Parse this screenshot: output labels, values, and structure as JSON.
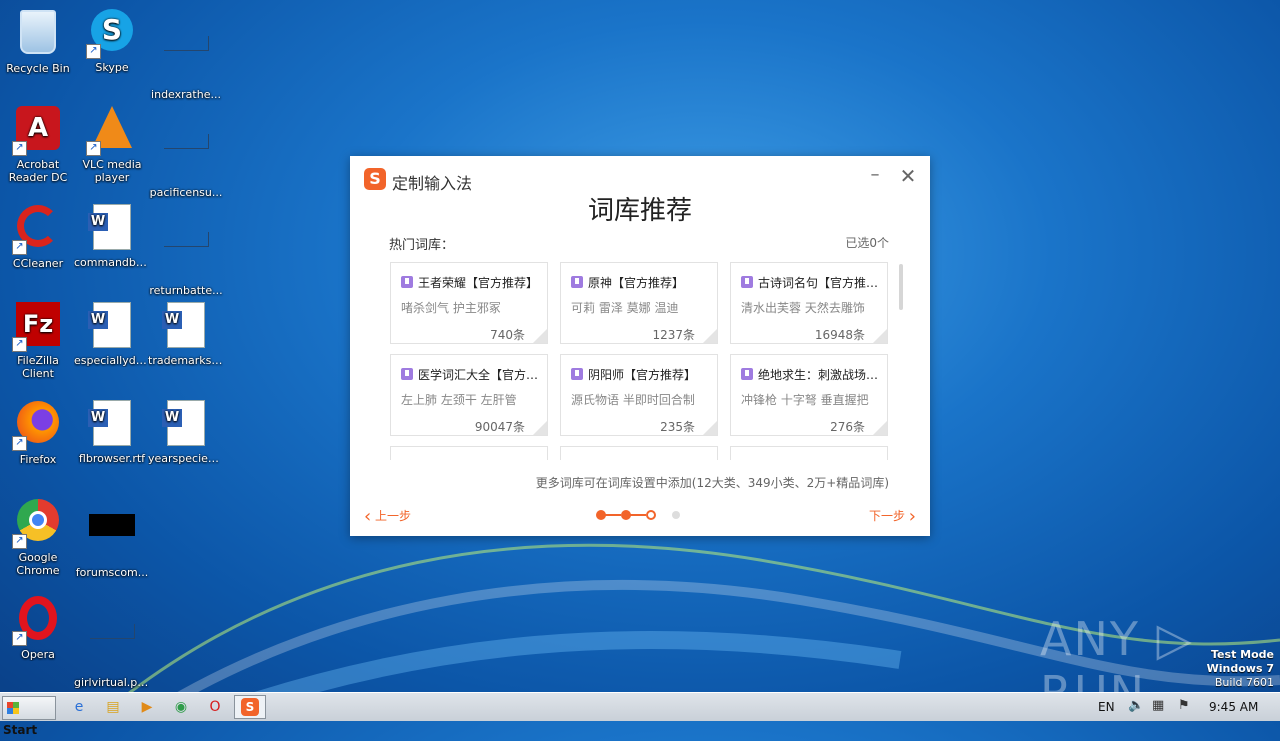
{
  "desktop_icons": [
    {
      "label": "Recycle Bin",
      "icon": "recycle-bin-icon"
    },
    {
      "label": "Skype",
      "icon": "skype-icon"
    },
    {
      "label": "indexrathe...",
      "icon": "blank-file-icon"
    },
    {
      "label": "Acrobat Reader DC",
      "icon": "acrobat-icon"
    },
    {
      "label": "VLC media player",
      "icon": "vlc-icon"
    },
    {
      "label": "pacificensu...",
      "icon": "blank-file-icon"
    },
    {
      "label": "CCleaner",
      "icon": "ccleaner-icon"
    },
    {
      "label": "commandbo...",
      "icon": "word-doc-icon"
    },
    {
      "label": "returnbatte...",
      "icon": "blank-file-icon"
    },
    {
      "label": "FileZilla Client",
      "icon": "filezilla-icon"
    },
    {
      "label": "especiallyde...",
      "icon": "word-doc-icon"
    },
    {
      "label": "trademarksc...",
      "icon": "word-doc-icon"
    },
    {
      "label": "Firefox",
      "icon": "firefox-icon"
    },
    {
      "label": "flbrowser.rtf",
      "icon": "word-doc-icon"
    },
    {
      "label": "yearspecies...",
      "icon": "word-doc-icon"
    },
    {
      "label": "Google Chrome",
      "icon": "chrome-icon"
    },
    {
      "label": "forumscom...",
      "icon": "black-image-icon"
    },
    {
      "label": "Opera",
      "icon": "opera-icon"
    },
    {
      "label": "girlvirtual.png",
      "icon": "blank-file-icon"
    }
  ],
  "dialog": {
    "app_title": "定制输入法",
    "logo_glyph": "S",
    "heading": "词库推荐",
    "section_label": "热门词库：",
    "selected_count": "已选0个",
    "cards": [
      {
        "title": "王者荣耀【官方推荐】",
        "desc": "啫杀剑气 护主邪冢",
        "count": "740条"
      },
      {
        "title": "原神【官方推荐】",
        "desc": "可莉 雷泽 莫娜 温迪",
        "count": "1237条"
      },
      {
        "title": "古诗词名句【官方推荐】",
        "desc": "清水出芙蓉 天然去雕饰",
        "count": "16948条"
      },
      {
        "title": "医学词汇大全【官方推荐】",
        "desc": "左上肺 左颈干 左肝管",
        "count": "90047条"
      },
      {
        "title": "阴阳师【官方推荐】",
        "desc": "源氏物语 半即时回合制",
        "count": "235条"
      },
      {
        "title": "绝地求生：刺激战场【官方推荐】",
        "desc": "冲锋枪 十字弩 垂直握把",
        "count": "276条"
      },
      {
        "title": "",
        "desc": "",
        "count": ""
      },
      {
        "title": "",
        "desc": "",
        "count": ""
      },
      {
        "title": "",
        "desc": "",
        "count": ""
      }
    ],
    "more_note": "更多词库可在词库设置中添加(12大类、349小类、2万+精品词库)",
    "prev_label": "上一步",
    "next_label": "下一步",
    "steps_total": 4,
    "current_step": 3
  },
  "watermark": "ANY ▷ RUN",
  "test_mode": {
    "line1": "Test Mode",
    "line2": "Windows 7",
    "line3": "Build 7601"
  },
  "taskbar": {
    "start_label": "Start",
    "pinned": [
      "ie-icon",
      "explorer-icon",
      "media-player-icon",
      "chrome-icon",
      "opera-icon",
      "sogou-icon"
    ],
    "language": "EN",
    "clock": "9:45 AM"
  }
}
